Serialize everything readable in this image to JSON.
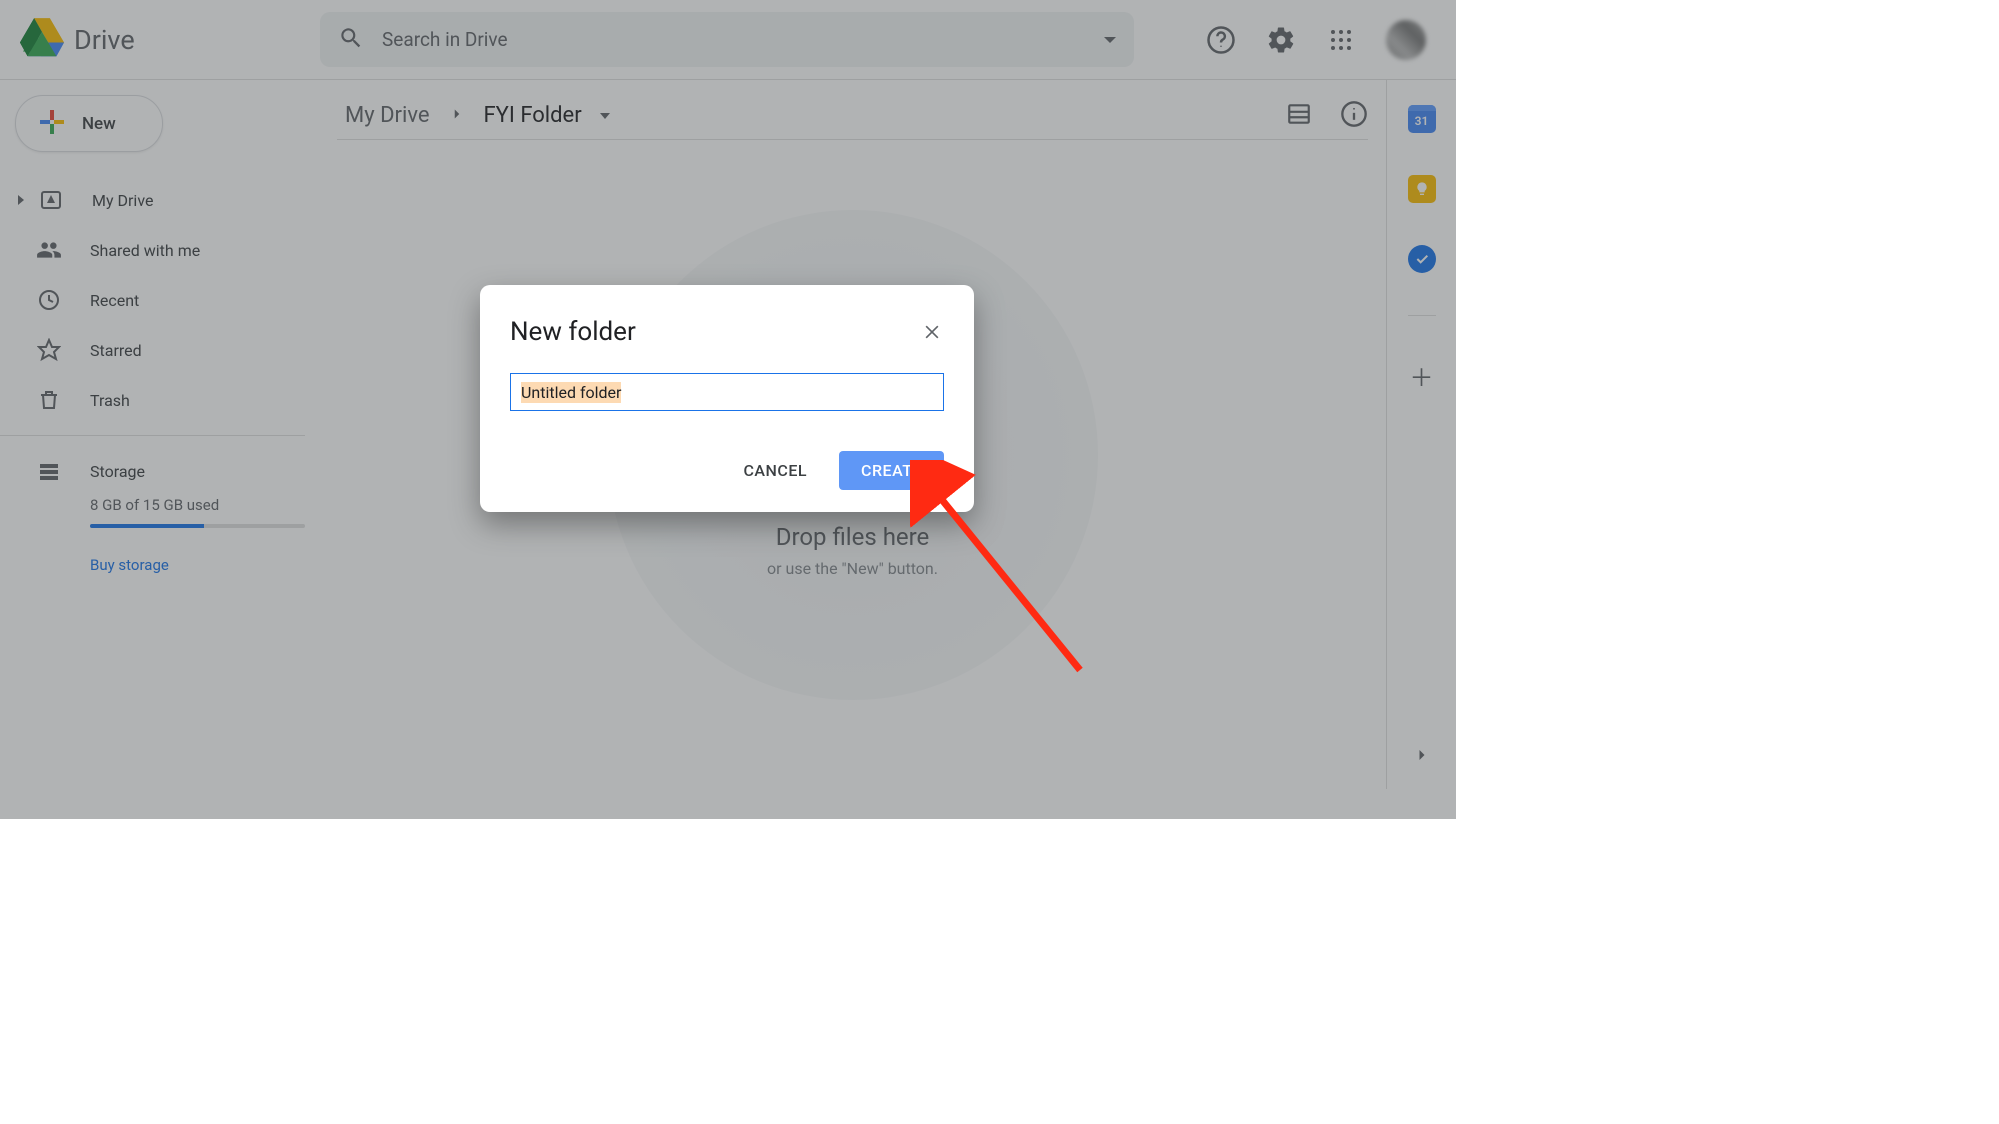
{
  "app": {
    "name": "Drive"
  },
  "search": {
    "placeholder": "Search in Drive"
  },
  "new_button": {
    "label": "New"
  },
  "sidebar": {
    "items": [
      {
        "label": "My Drive"
      },
      {
        "label": "Shared with me"
      },
      {
        "label": "Recent"
      },
      {
        "label": "Starred"
      },
      {
        "label": "Trash"
      }
    ],
    "storage": {
      "label": "Storage",
      "used_text": "8 GB of 15 GB used",
      "buy_label": "Buy storage",
      "percent": 53
    }
  },
  "breadcrumbs": {
    "root": "My Drive",
    "current": "FYI Folder"
  },
  "empty_state": {
    "line1": "Drop files here",
    "line2": "or use the \"New\" button."
  },
  "sidepanel": {
    "calendar_day": "31"
  },
  "dialog": {
    "title": "New folder",
    "input_value": "Untitled folder",
    "cancel": "CANCEL",
    "create": "CREATE"
  }
}
